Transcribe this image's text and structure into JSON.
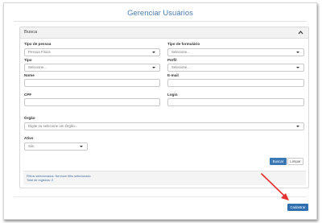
{
  "page": {
    "title": "Gerenciar Usuários"
  },
  "panel": {
    "title": "Busca"
  },
  "form": {
    "tipo_pessoa": {
      "label": "Tipo de pessoa",
      "value": "Pessoa Física"
    },
    "tipo_formulario": {
      "label": "Tipo de formulário",
      "placeholder": "Selecione..."
    },
    "tipo": {
      "label": "Tipo",
      "placeholder": "Selecione..."
    },
    "perfil": {
      "label": "Perfil",
      "placeholder": "Selecione..."
    },
    "nome": {
      "label": "Nome",
      "value": ""
    },
    "email": {
      "label": "E-mail",
      "value": ""
    },
    "cpf": {
      "label": "CPF",
      "value": ""
    },
    "login": {
      "label": "Login",
      "value": ""
    },
    "orgao": {
      "label": "Órgão",
      "placeholder": "Digite ou  selecione um Órgão..."
    },
    "ativo": {
      "label": "Ativo",
      "value": "Sim"
    }
  },
  "actions": {
    "buscar": "Buscar",
    "limpar": "Limpar",
    "cadastrar": "Cadastrar"
  },
  "summary": {
    "filtros": "Filtros selecionados: Nenhum filtro selecionado",
    "total": "Total de registros: 0"
  },
  "colors": {
    "accent": "#3a78b6",
    "title": "#4a7fb2",
    "arrow": "#e53030"
  }
}
